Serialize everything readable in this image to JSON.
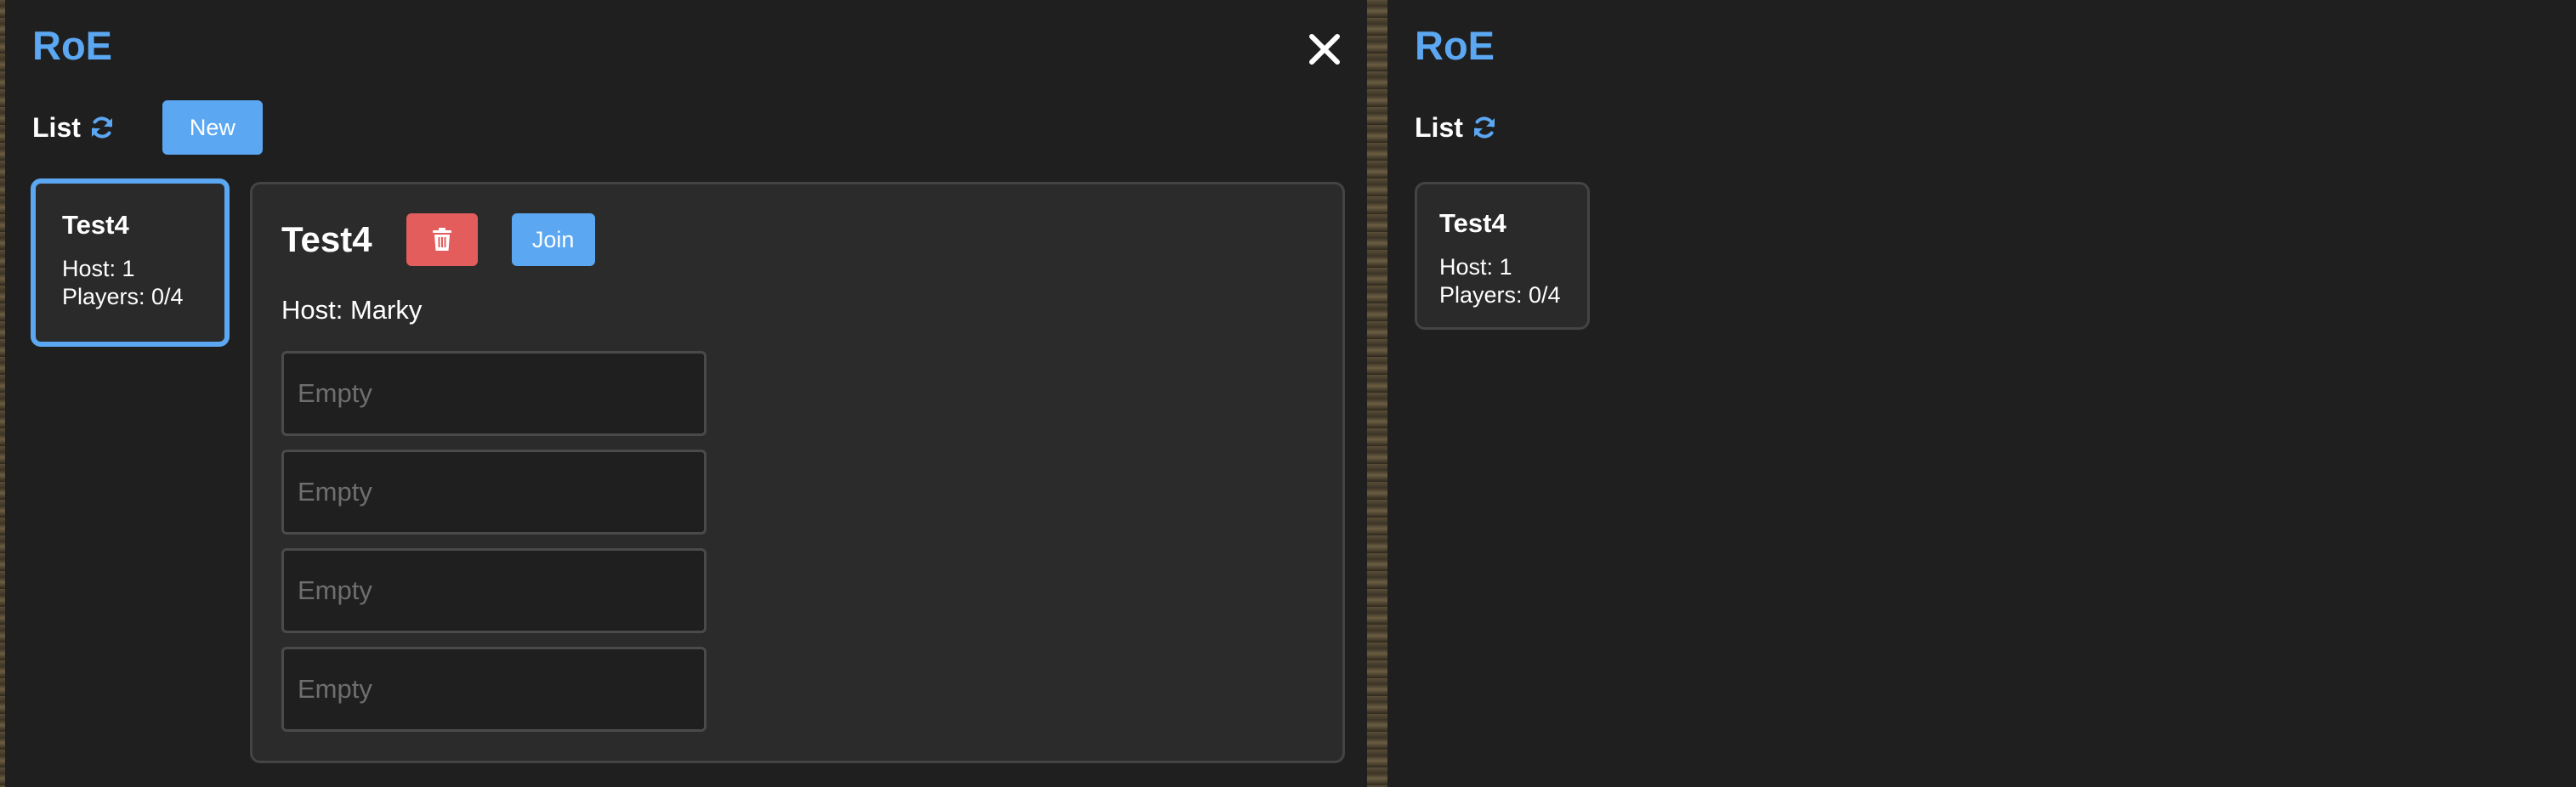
{
  "app": {
    "title": "RoE"
  },
  "colors": {
    "accent": "#5ba7f2",
    "danger": "#e35d5d",
    "window_bg": "#1f1f1f",
    "panel_bg": "#2b2b2b"
  },
  "icons": {
    "close": "close-icon",
    "refresh": "refresh-icon",
    "delete": "trash-icon"
  },
  "left_window": {
    "list_label": "List",
    "new_button_label": "New",
    "rooms": [
      {
        "name": "Test4",
        "host_line": "Host: 1",
        "players_line": "Players: 0/4",
        "selected": true
      }
    ],
    "detail": {
      "name": "Test4",
      "join_label": "Join",
      "host_line": "Host: Marky",
      "slots": [
        {
          "value": "",
          "placeholder": "Empty"
        },
        {
          "value": "",
          "placeholder": "Empty"
        },
        {
          "value": "",
          "placeholder": "Empty"
        },
        {
          "value": "",
          "placeholder": "Empty"
        }
      ]
    }
  },
  "right_window": {
    "list_label": "List",
    "rooms": [
      {
        "name": "Test4",
        "host_line": "Host: 1",
        "players_line": "Players: 0/4",
        "selected": false
      }
    ]
  }
}
